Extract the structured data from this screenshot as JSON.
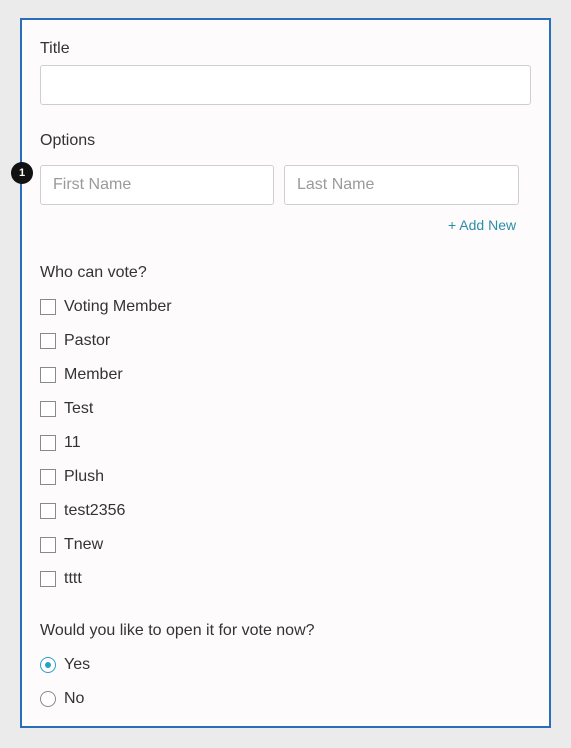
{
  "form": {
    "title_label": "Title",
    "title_value": "",
    "options_label": "Options",
    "option_badge": "1",
    "first_name_placeholder": "First Name",
    "last_name_placeholder": "Last Name",
    "add_new_label": "+ Add New",
    "who_can_vote_label": "Who can vote?",
    "voters": [
      {
        "label": "Voting Member",
        "checked": false
      },
      {
        "label": "Pastor",
        "checked": false
      },
      {
        "label": "Member",
        "checked": false
      },
      {
        "label": "Test",
        "checked": false
      },
      {
        "label": "11",
        "checked": false
      },
      {
        "label": "Plush",
        "checked": false
      },
      {
        "label": "test2356",
        "checked": false
      },
      {
        "label": "Tnew",
        "checked": false
      },
      {
        "label": "tttt",
        "checked": false
      }
    ],
    "open_vote_label": "Would you like to open it for vote now?",
    "open_vote_options": [
      {
        "label": "Yes",
        "selected": true
      },
      {
        "label": "No",
        "selected": false
      }
    ]
  },
  "colors": {
    "panel_border": "#2a6ebb",
    "link": "#2a8fa8",
    "radio_selected": "#2a9fc9"
  }
}
